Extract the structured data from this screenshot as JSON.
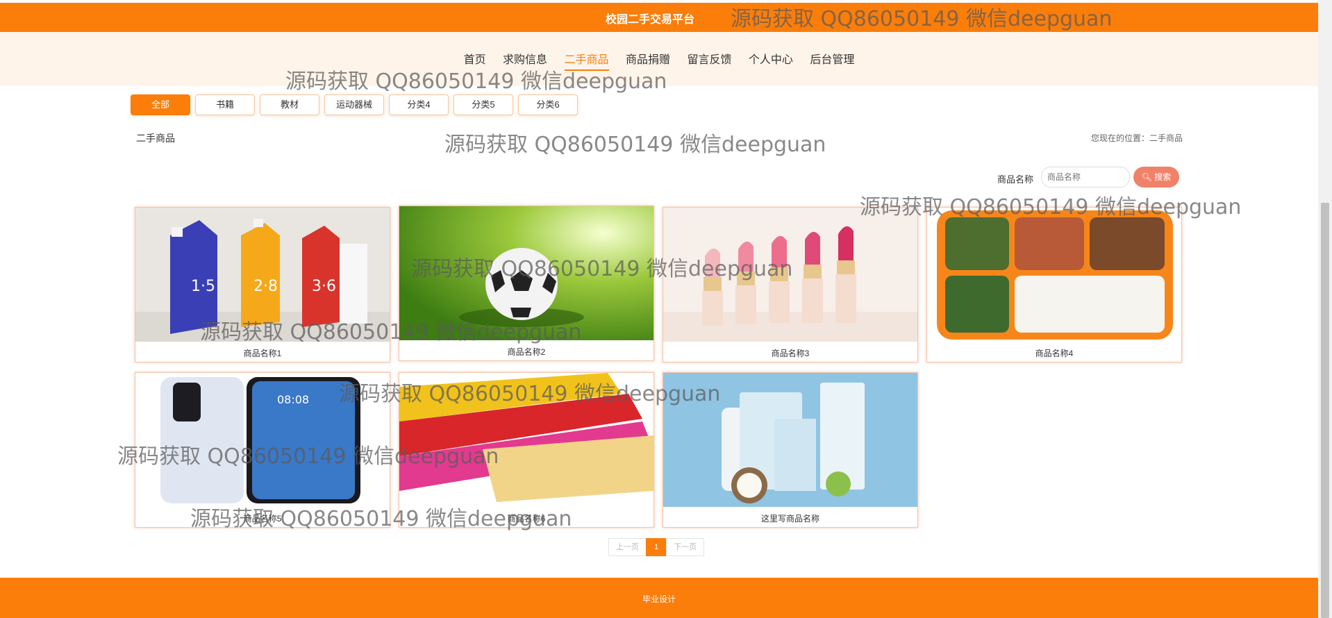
{
  "header": {
    "title": "校园二手交易平台"
  },
  "nav": {
    "items": [
      {
        "label": "首页"
      },
      {
        "label": "求购信息"
      },
      {
        "label": "二手商品"
      },
      {
        "label": "商品捐赠"
      },
      {
        "label": "留言反馈"
      },
      {
        "label": "个人中心"
      },
      {
        "label": "后台管理"
      }
    ],
    "active_index": 2
  },
  "category_tabs": [
    "全部",
    "书籍",
    "教材",
    "运动器械",
    "分类4",
    "分类5",
    "分类6"
  ],
  "breadcrumb": {
    "section": "二手商品",
    "location": "您现在的位置：二手商品"
  },
  "search": {
    "label": "商品名称",
    "placeholder": "商品名称",
    "button": "搜索"
  },
  "products": [
    {
      "name": "商品名称1"
    },
    {
      "name": "商品名称2"
    },
    {
      "name": "商品名称3"
    },
    {
      "name": "商品名称4"
    },
    {
      "name": "商品名称5"
    },
    {
      "name": "商品名称6"
    },
    {
      "name": "这里写商品名称"
    }
  ],
  "pagination": {
    "prev": "上一页",
    "current": "1",
    "next": "下一页"
  },
  "footer": {
    "text": "毕业设计"
  },
  "watermark": {
    "text": "源码获取 QQ86050149 微信deepguan"
  },
  "colors": {
    "accent": "#fb7d0a",
    "nav_bg": "#fff4ea",
    "search_button": "#f0826a"
  }
}
